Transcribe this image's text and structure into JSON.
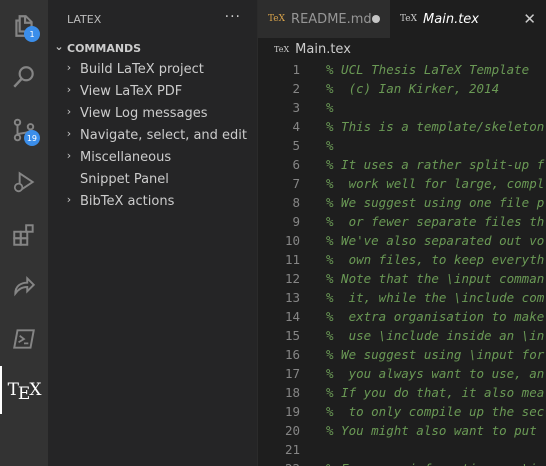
{
  "activity_bar": {
    "explorer_badge": "1",
    "scm_badge": "19",
    "tex_label": "TeX"
  },
  "sidebar": {
    "header": "LATEX",
    "more_actions": "···",
    "section_title": "COMMANDS",
    "items": [
      {
        "label": "Build LaTeX project",
        "expandable": true
      },
      {
        "label": "View LaTeX PDF",
        "expandable": true
      },
      {
        "label": "View Log messages",
        "expandable": true
      },
      {
        "label": "Navigate, select, and edit",
        "expandable": true
      },
      {
        "label": "Miscellaneous",
        "expandable": true
      },
      {
        "label": "Snippet Panel",
        "expandable": false
      },
      {
        "label": "BibTeX actions",
        "expandable": true
      }
    ]
  },
  "tabs": [
    {
      "label": "README.md",
      "icon": "TeX",
      "state": "modified"
    },
    {
      "label": "Main.tex",
      "icon": "TeX",
      "state": "active"
    }
  ],
  "breadcrumb": {
    "file": "Main.tex",
    "icon": "TeX"
  },
  "editor": {
    "lines": [
      {
        "n": "1",
        "text": "% UCL Thesis LaTeX Template"
      },
      {
        "n": "2",
        "text": "%  (c) Ian Kirker, 2014"
      },
      {
        "n": "3",
        "text": "%"
      },
      {
        "n": "4",
        "text": "% This is a template/skeleton"
      },
      {
        "n": "5",
        "text": "%"
      },
      {
        "n": "6",
        "text": "% It uses a rather split-up f"
      },
      {
        "n": "7",
        "text": "%  work well for large, compl"
      },
      {
        "n": "8",
        "text": "% We suggest using one file p"
      },
      {
        "n": "9",
        "text": "%  or fewer separate files th"
      },
      {
        "n": "10",
        "text": "% We've also separated out vo"
      },
      {
        "n": "11",
        "text": "%  own files, to keep everyth"
      },
      {
        "n": "12",
        "text": "% Note that the \\input comman"
      },
      {
        "n": "13",
        "text": "%  it, while the \\include com"
      },
      {
        "n": "14",
        "text": "%  extra organisation to make"
      },
      {
        "n": "15",
        "text": "%  use \\include inside an \\in"
      },
      {
        "n": "16",
        "text": "% We suggest using \\input for"
      },
      {
        "n": "17",
        "text": "%  you always want to use, an"
      },
      {
        "n": "18",
        "text": "% If you do that, it also mea"
      },
      {
        "n": "19",
        "text": "%  to only compile up the sec"
      },
      {
        "n": "20",
        "text": "% You might also want to put"
      },
      {
        "n": "21",
        "text": ""
      },
      {
        "n": "22",
        "text": "% For more information on \\in"
      }
    ]
  }
}
